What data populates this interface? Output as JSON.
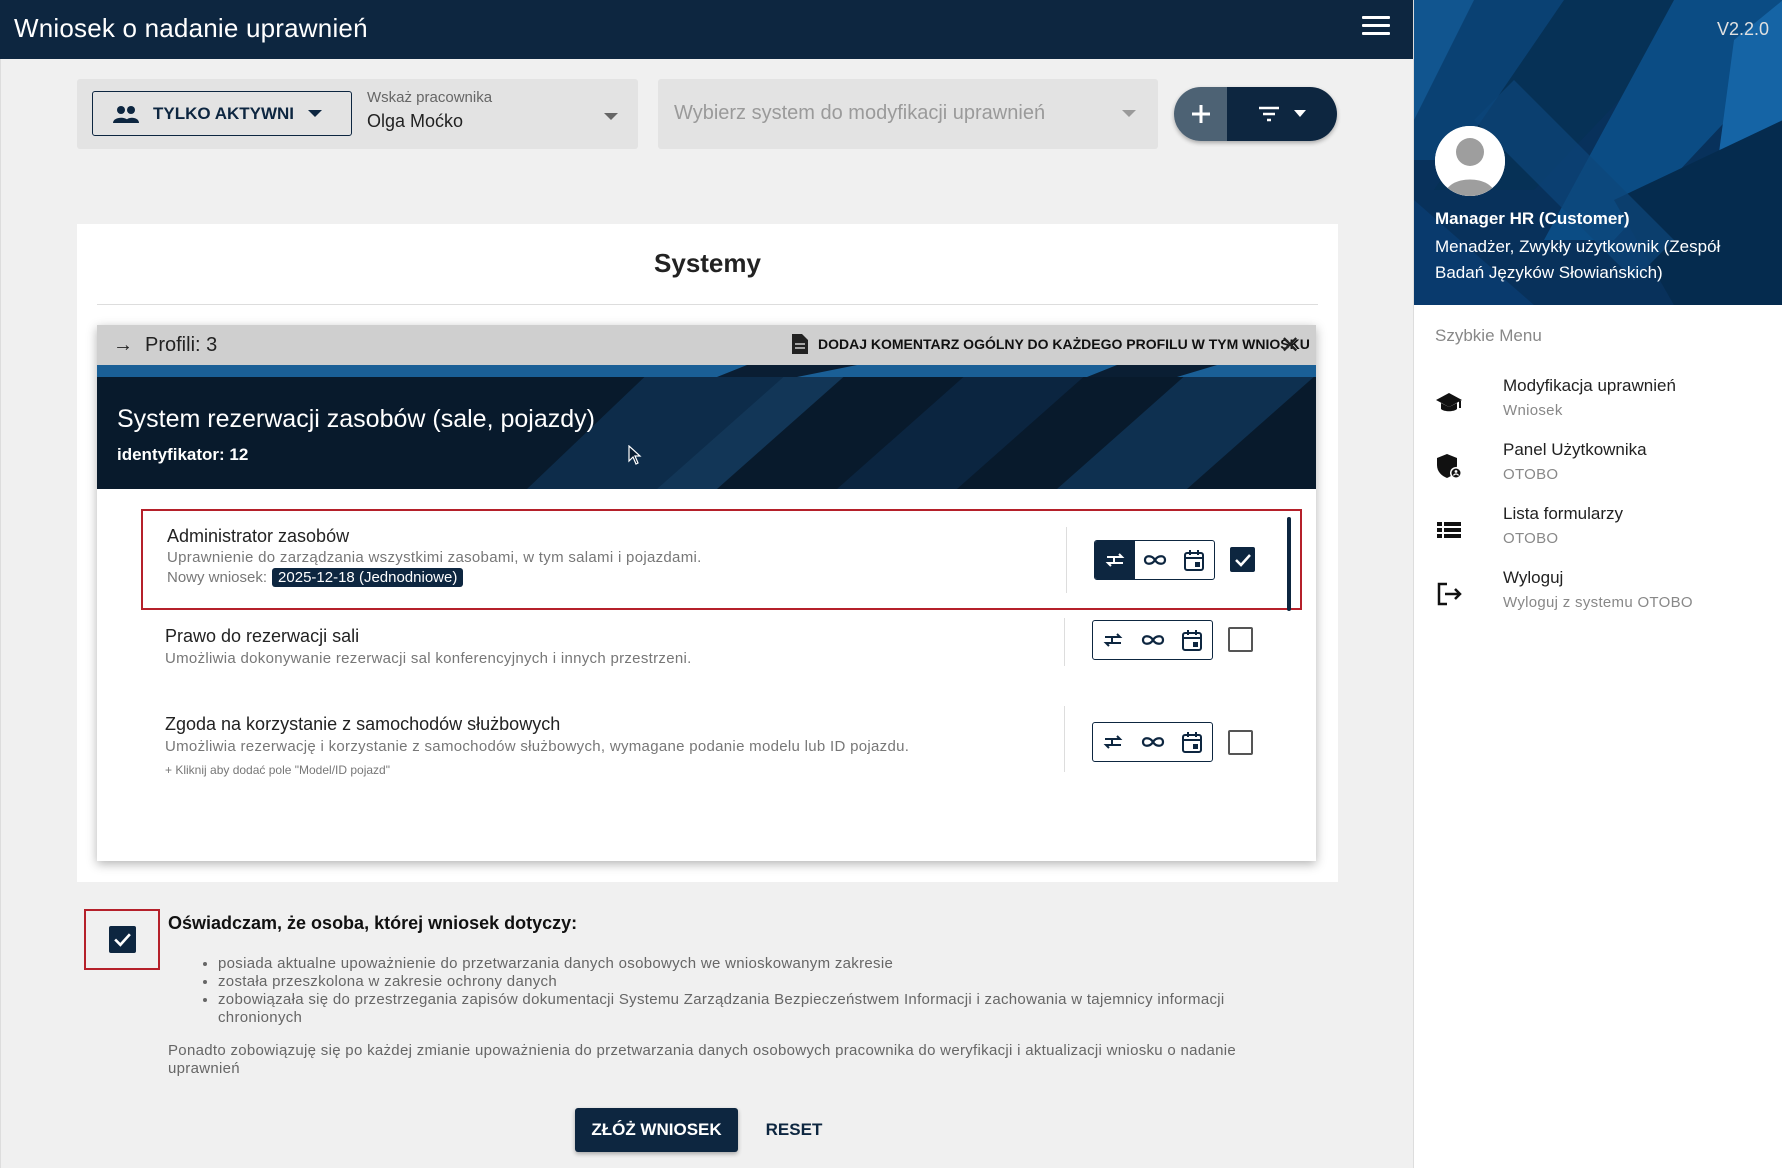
{
  "header": {
    "title": "Wniosek o nadanie uprawnień"
  },
  "filters": {
    "active_label": "TYLKO AKTYWNI",
    "employee_label": "Wskaż pracownika",
    "employee_value": "Olga Moćko",
    "system_placeholder": "Wybierz system do modyfikacji uprawnień"
  },
  "systems": {
    "heading": "Systemy",
    "profiles_label": "Profili: 3",
    "comment_label": "DODAJ KOMENTARZ OGÓLNY DO KAŻDEGO PROFILU W TYM WNIOSKU",
    "system_name": "System rezerwacji zasobów (sale, pojazdy)",
    "system_id": "identyfikator: 12",
    "permissions": [
      {
        "title": "Administrator zasobów",
        "description": "Uprawnienie do zarządzania wszystkimi zasobami, w tym salami i pojazdami.",
        "new_request_label": "Nowy wniosek:",
        "badge": "2025-12-18 (Jednodniowe)",
        "checked": true
      },
      {
        "title": "Prawo do rezerwacji sali",
        "description": "Umożliwia dokonywanie rezerwacji sal konferencyjnych i innych przestrzeni.",
        "checked": false
      },
      {
        "title": "Zgoda na korzystanie z samochodów służbowych",
        "description": "Umożliwia rezerwację i korzystanie z samochodów służbowych, wymagane podanie modelu lub ID pojazdu.",
        "add_field": "+ Kliknij aby dodać pole \"Model/ID pojazd\"",
        "checked": false
      }
    ]
  },
  "declaration": {
    "title": "Oświadczam, że osoba, której wniosek dotyczy:",
    "items": [
      "posiada aktualne upoważnienie do przetwarzania danych osobowych we wnioskowanym zakresie",
      "została przeszkolona w zakresie ochrony danych",
      "zobowiązała się do przestrzegania zapisów dokumentacji Systemu Zarządzania Bezpieczeństwem Informacji i zachowania w tajemnicy informacji chronionych"
    ],
    "note": "Ponadto zobowiązuję się po każdej zmianie upoważnienia do przetwarzania danych osobowych pracownika do weryfikacji i aktualizacji wniosku o nadanie uprawnień",
    "checked": true
  },
  "actions": {
    "submit": "ZŁÓŻ WNIOSEK",
    "reset": "RESET"
  },
  "sidebar": {
    "version": "V2.2.0",
    "user_name": "Manager HR (Customer)",
    "user_role": "Menadżer, Zwykły użytkownik (Zespół Badań Języków Słowiańskich)",
    "menu_title": "Szybkie Menu",
    "items": [
      {
        "label": "Modyfikacja uprawnień",
        "sub": "Wniosek",
        "icon": "graduation-cap-icon"
      },
      {
        "label": "Panel Użytkownika",
        "sub": "OTOBO",
        "icon": "shield-user-icon"
      },
      {
        "label": "Lista formularzy",
        "sub": "OTOBO",
        "icon": "list-icon"
      },
      {
        "label": "Wyloguj",
        "sub": "Wyloguj z systemu OTOBO",
        "icon": "logout-icon"
      }
    ]
  },
  "colors": {
    "navy": "#0d2640",
    "highlight_red": "#b5202a",
    "sidebar_blue": "#0b3f73"
  }
}
